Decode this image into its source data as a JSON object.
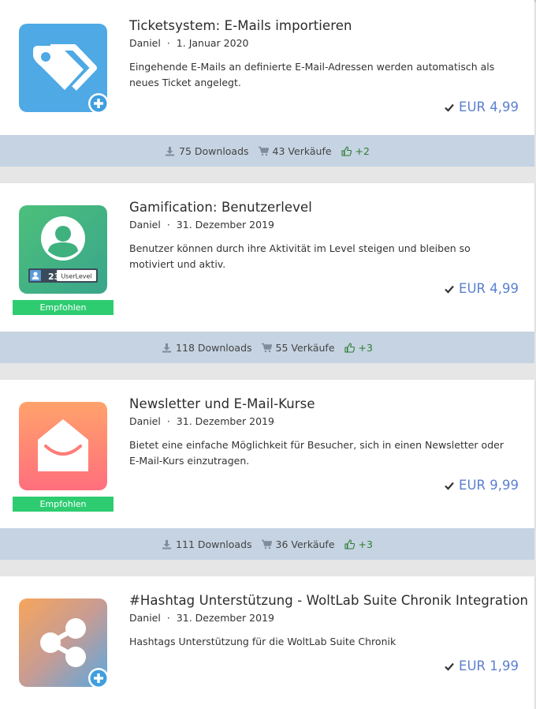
{
  "items": [
    {
      "title": "Ticketsystem: E-Mails importieren",
      "author": "Daniel",
      "date": "1. Januar 2020",
      "description": "Eingehende E-Mails an definierte E-Mail-Adressen werden automatisch als neues Ticket angelegt.",
      "price": "EUR 4,99",
      "downloads": "75 Downloads",
      "sales": "43 Verkäufe",
      "likes": "+2",
      "icon": "tag-icon",
      "recommended": null
    },
    {
      "title": "Gamification: Benutzerlevel",
      "author": "Daniel",
      "date": "31. Dezember 2019",
      "description": "Benutzer können durch ihre Aktivität im Level steigen und bleiben so motiviert und aktiv.",
      "price": "EUR 4,99",
      "downloads": "118 Downloads",
      "sales": "55 Verkäufe",
      "likes": "+3",
      "icon": "user-level-icon",
      "badge_number": "23",
      "badge_label": "UserLevel",
      "recommended": "Empfohlen"
    },
    {
      "title": "Newsletter und E-Mail-Kurse",
      "author": "Daniel",
      "date": "31. Dezember 2019",
      "description": "Bietet eine einfache Möglichkeit für Besucher, sich in einen Newsletter oder E-Mail-Kurs einzutragen.",
      "price": "EUR 9,99",
      "downloads": "111 Downloads",
      "sales": "36 Verkäufe",
      "likes": "+3",
      "icon": "envelope-icon",
      "recommended": "Empfohlen"
    },
    {
      "title": "#Hashtag Unterstützung - WoltLab Suite Chronik Integration",
      "author": "Daniel",
      "date": "31. Dezember 2019",
      "description": "Hashtags Unterstützung für die WoltLab Suite Chronik",
      "price": "EUR 1,99",
      "icon": "share-icon",
      "recommended": null
    }
  ],
  "meta_separator": "·",
  "colors": {
    "price": "#5b7fcf",
    "recommended": "#2ecc71",
    "stats_bar": "#c5d3e2",
    "likes": "#2e7d32"
  }
}
